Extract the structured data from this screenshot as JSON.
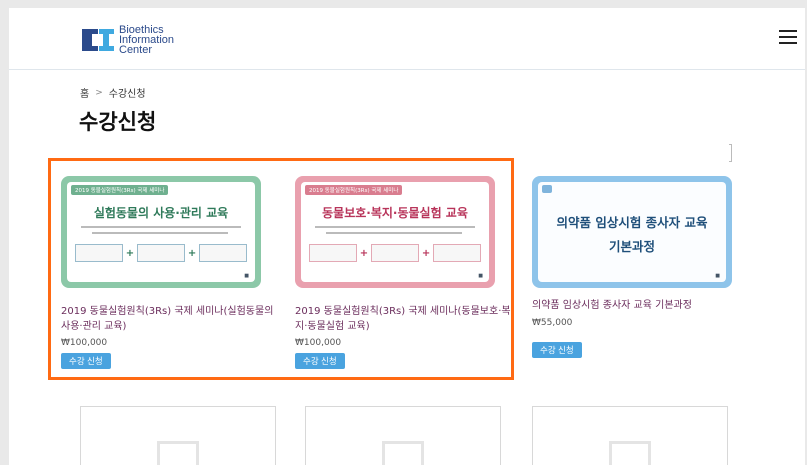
{
  "header": {
    "logo_line1": "Bioethics",
    "logo_line2": "Information",
    "logo_line3": "Center",
    "menu_icon": "hamburger-menu-icon"
  },
  "breadcrumb": {
    "home": "홈",
    "separator": ">",
    "current": "수강신청"
  },
  "page_title": "수강신청",
  "courses": [
    {
      "thumb_tag": "2019 동물실험원칙(3Rs) 국제 세미나",
      "thumb_title": "실험동물의 사용·관리 교육",
      "title": "2019 동물실험원칙(3Rs) 국제 세미나(실험동물의 사용·관리 교육)",
      "price": "₩100,000",
      "button": "수강 신청",
      "theme": "#8cc8a8"
    },
    {
      "thumb_tag": "2019 동물실험원칙(3Rs) 국제 세미나",
      "thumb_title": "동물보호·복지·동물실험 교육",
      "title": "2019 동물실험원칙(3Rs) 국제 세미나(동물보호·복지·동물실험 교육)",
      "price": "₩100,000",
      "button": "수강 신청",
      "theme": "#e9a0ae"
    },
    {
      "thumb_title_line1": "의약품 임상시험 종사자 교육",
      "thumb_title_line2": "기본과정",
      "title": "의약품 임상시험 종사자 교육 기본과정",
      "price": "₩55,000",
      "button": "수강 신청",
      "theme": "#8ec4ea"
    }
  ],
  "colors": {
    "highlight": "#ff6a13",
    "button": "#4aa3df",
    "course_title": "#6b2d5c"
  }
}
